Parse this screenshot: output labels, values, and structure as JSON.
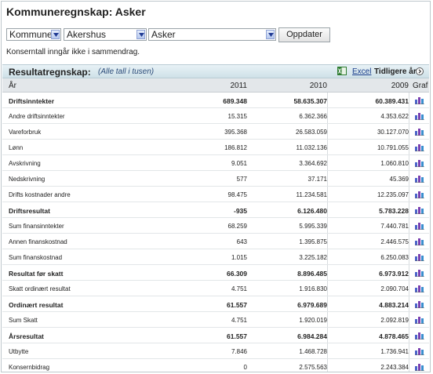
{
  "page_title": "Kommuneregnskap: Asker",
  "filters": {
    "type_value": "Kommune",
    "county_value": "Akershus",
    "municipality_value": "Asker",
    "submit_label": "Oppdater"
  },
  "note": "Konserntall inngår ikke i sammendrag.",
  "section": {
    "title": "Resultatregnskap:",
    "subtitle": "(Alle tall i tusen)",
    "excel_label": "Excel",
    "earlier_years_label": "Tidligere år"
  },
  "table": {
    "headers": [
      "År",
      "2011",
      "2010",
      "2009",
      "Graf"
    ],
    "rows": [
      {
        "label": "Driftsinntekter",
        "bold": true,
        "y2011": "689.348",
        "y2010": "58.635.307",
        "y2009": "60.389.431"
      },
      {
        "label": "Andre driftsinntekter",
        "bold": false,
        "y2011": "15.315",
        "y2010": "6.362.366",
        "y2009": "4.353.622"
      },
      {
        "label": "Vareforbruk",
        "bold": false,
        "y2011": "395.368",
        "y2010": "26.583.059",
        "y2009": "30.127.070"
      },
      {
        "label": "Lønn",
        "bold": false,
        "y2011": "186.812",
        "y2010": "11.032.136",
        "y2009": "10.791.055"
      },
      {
        "label": "Avskrivning",
        "bold": false,
        "y2011": "9.051",
        "y2010": "3.364.692",
        "y2009": "1.060.810"
      },
      {
        "label": "Nedskrivning",
        "bold": false,
        "y2011": "577",
        "y2010": "37.171",
        "y2009": "45.369"
      },
      {
        "label": "Drifts kostnader andre",
        "bold": false,
        "y2011": "98.475",
        "y2010": "11.234.581",
        "y2009": "12.235.097"
      },
      {
        "label": "Driftsresultat",
        "bold": true,
        "y2011": "-935",
        "y2010": "6.126.480",
        "y2009": "5.783.228"
      },
      {
        "label": "Sum finansinntekter",
        "bold": false,
        "y2011": "68.259",
        "y2010": "5.995.339",
        "y2009": "7.440.781"
      },
      {
        "label": "Annen finanskostnad",
        "bold": false,
        "y2011": "643",
        "y2010": "1.395.875",
        "y2009": "2.446.575"
      },
      {
        "label": "Sum finanskostnad",
        "bold": false,
        "y2011": "1.015",
        "y2010": "3.225.182",
        "y2009": "6.250.083"
      },
      {
        "label": "Resultat før skatt",
        "bold": true,
        "y2011": "66.309",
        "y2010": "8.896.485",
        "y2009": "6.973.912"
      },
      {
        "label": "Skatt ordinært resultat",
        "bold": false,
        "y2011": "4.751",
        "y2010": "1.916.830",
        "y2009": "2.090.704"
      },
      {
        "label": "Ordinært resultat",
        "bold": true,
        "y2011": "61.557",
        "y2010": "6.979.689",
        "y2009": "4.883.214"
      },
      {
        "label": "Sum Skatt",
        "bold": false,
        "y2011": "4.751",
        "y2010": "1.920.019",
        "y2009": "2.092.819"
      },
      {
        "label": "Årsresultat",
        "bold": true,
        "y2011": "61.557",
        "y2010": "6.984.284",
        "y2009": "4.878.465"
      },
      {
        "label": "Utbytte",
        "bold": false,
        "y2011": "7.846",
        "y2010": "1.468.728",
        "y2009": "1.736.941"
      },
      {
        "label": "Konsernbidrag",
        "bold": false,
        "y2011": "0",
        "y2010": "2.575.563",
        "y2009": "2.243.384"
      }
    ]
  },
  "icons": {
    "graph": "bar-chart-icon",
    "excel": "excel-icon",
    "earlier": "arrow-right-circle-icon"
  },
  "colors": {
    "header_band": "#cfe1e8",
    "link": "#1a3e8c",
    "graph_bars": [
      "#4a63c8",
      "#7a3fb0",
      "#3a8fcf"
    ]
  }
}
